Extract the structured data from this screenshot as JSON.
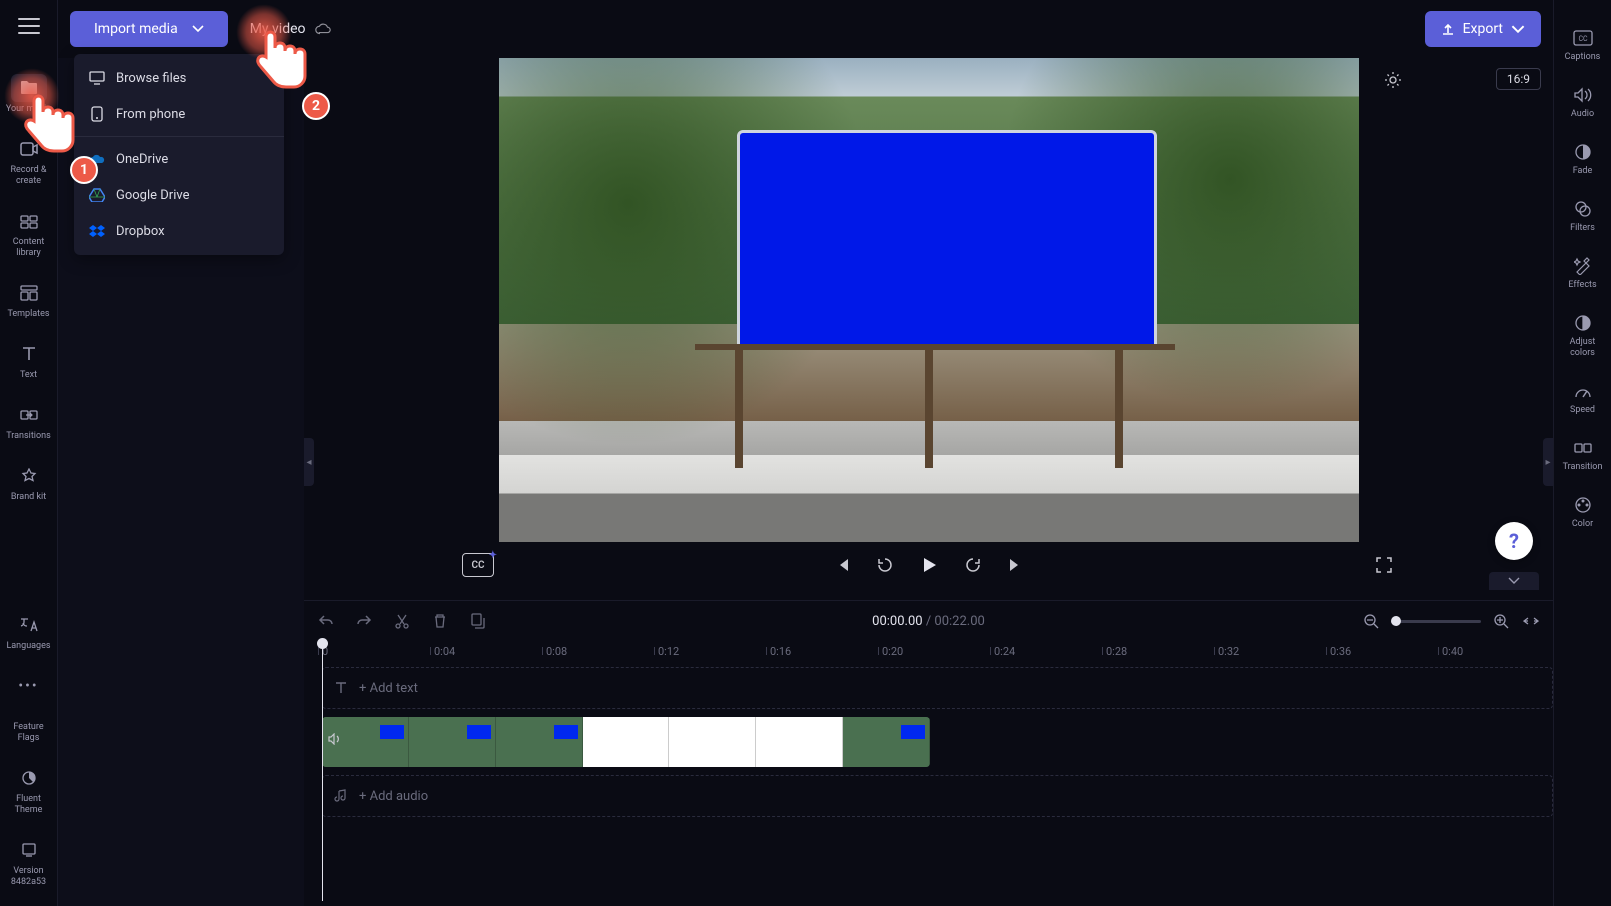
{
  "topbar": {
    "import_label": "Import media",
    "project_title": "My video",
    "export_label": "Export"
  },
  "dropdown": {
    "browse_files": "Browse files",
    "from_phone": "From phone",
    "onedrive": "OneDrive",
    "google_drive": "Google Drive",
    "dropbox": "Dropbox"
  },
  "left_sidebar": {
    "your_media": "Your media",
    "record_create": "Record & create",
    "content_library": "Content library",
    "templates": "Templates",
    "text": "Text",
    "transitions": "Transitions",
    "brand_kit": "Brand kit",
    "languages": "Languages",
    "feature_flags": "Feature Flags",
    "fluent_theme": "Fluent Theme",
    "version": "Version 8482a53"
  },
  "right_sidebar": {
    "captions": "Captions",
    "audio": "Audio",
    "fade": "Fade",
    "filters": "Filters",
    "effects": "Effects",
    "adjust_colors": "Adjust colors",
    "speed": "Speed",
    "transition": "Transition",
    "color": "Color"
  },
  "preview": {
    "ratio": "16:9",
    "cc": "CC"
  },
  "timeline": {
    "time_current": "00:00.00",
    "time_total": "00:22.00",
    "add_text": "+ Add text",
    "add_audio": "+ Add audio",
    "ticks": [
      "0",
      "0:04",
      "0:08",
      "0:12",
      "0:16",
      "0:20",
      "0:24",
      "0:28",
      "0:32",
      "0:36",
      "0:40"
    ]
  },
  "annotations": {
    "step1": "1",
    "step2": "2"
  },
  "help": "?"
}
